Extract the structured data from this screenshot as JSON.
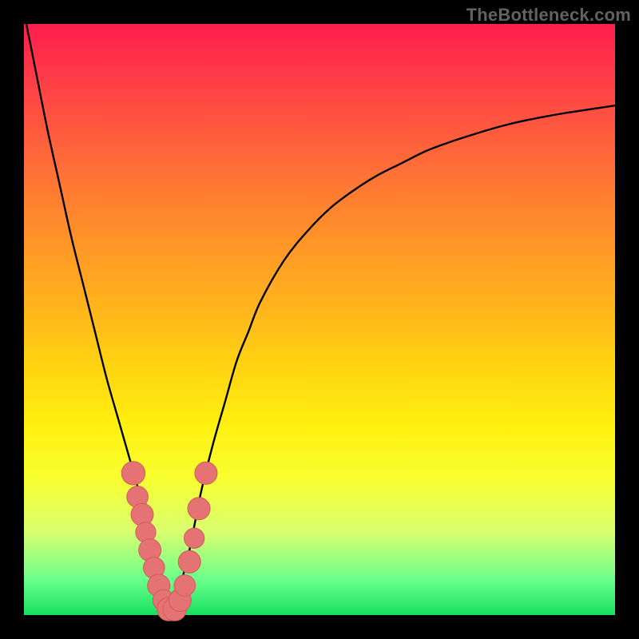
{
  "watermark": "TheBottleneck.com",
  "colors": {
    "frame": "#000000",
    "curve": "#000000",
    "marker_fill": "#e57373",
    "marker_stroke": "#d15b5b",
    "gradient_stops": [
      "#ff1d4c",
      "#ff3848",
      "#ff5a3e",
      "#ff7a32",
      "#ff9826",
      "#ffb41c",
      "#ffd411",
      "#fff010",
      "#f8ff30",
      "#d8ff70",
      "#6bff8b",
      "#18e060"
    ]
  },
  "chart_data": {
    "type": "line",
    "title": "",
    "xlabel": "",
    "ylabel": "",
    "xlim": [
      0,
      100
    ],
    "ylim": [
      0,
      100
    ],
    "grid": false,
    "legend": false,
    "x": [
      0,
      2,
      4,
      6,
      8,
      10,
      12,
      14,
      16,
      18,
      20,
      21,
      22,
      23,
      24,
      25,
      26,
      27,
      28,
      29,
      30,
      32,
      34,
      36,
      38,
      40,
      44,
      48,
      52,
      56,
      60,
      64,
      68,
      72,
      76,
      80,
      84,
      88,
      92,
      96,
      100
    ],
    "series": [
      {
        "name": "left-branch",
        "x": [
          0,
          2,
          4,
          6,
          8,
          10,
          12,
          14,
          16,
          18,
          20,
          21,
          22,
          23,
          24,
          25
        ],
        "values": [
          102,
          92,
          82,
          73,
          64,
          56,
          48,
          40,
          33,
          26,
          19,
          15,
          11,
          7,
          3,
          0
        ]
      },
      {
        "name": "right-branch",
        "x": [
          25,
          26,
          27,
          28,
          29,
          30,
          32,
          34,
          36,
          38,
          40,
          44,
          48,
          52,
          56,
          60,
          64,
          68,
          72,
          76,
          80,
          84,
          88,
          92,
          96,
          100
        ],
        "values": [
          0,
          3,
          7,
          11,
          16,
          21,
          29,
          36,
          43,
          48,
          53,
          60,
          65,
          69,
          72,
          74.5,
          76.5,
          78.5,
          80,
          81.3,
          82.5,
          83.5,
          84.3,
          85,
          85.6,
          86.2
        ]
      }
    ],
    "markers": [
      {
        "x": 18.5,
        "y": 24,
        "r": 1.6
      },
      {
        "x": 19.2,
        "y": 20,
        "r": 1.4
      },
      {
        "x": 20.0,
        "y": 17,
        "r": 1.5
      },
      {
        "x": 20.6,
        "y": 14,
        "r": 1.3
      },
      {
        "x": 21.3,
        "y": 11,
        "r": 1.5
      },
      {
        "x": 22.0,
        "y": 8,
        "r": 1.4
      },
      {
        "x": 22.8,
        "y": 5,
        "r": 1.5
      },
      {
        "x": 23.6,
        "y": 2.5,
        "r": 1.4
      },
      {
        "x": 24.5,
        "y": 1,
        "r": 1.6
      },
      {
        "x": 25.5,
        "y": 1,
        "r": 1.6
      },
      {
        "x": 26.4,
        "y": 2.5,
        "r": 1.5
      },
      {
        "x": 27.2,
        "y": 5,
        "r": 1.4
      },
      {
        "x": 28.0,
        "y": 9,
        "r": 1.5
      },
      {
        "x": 28.8,
        "y": 13,
        "r": 1.3
      },
      {
        "x": 29.6,
        "y": 18,
        "r": 1.5
      },
      {
        "x": 30.8,
        "y": 24,
        "r": 1.5
      }
    ],
    "annotations": []
  }
}
